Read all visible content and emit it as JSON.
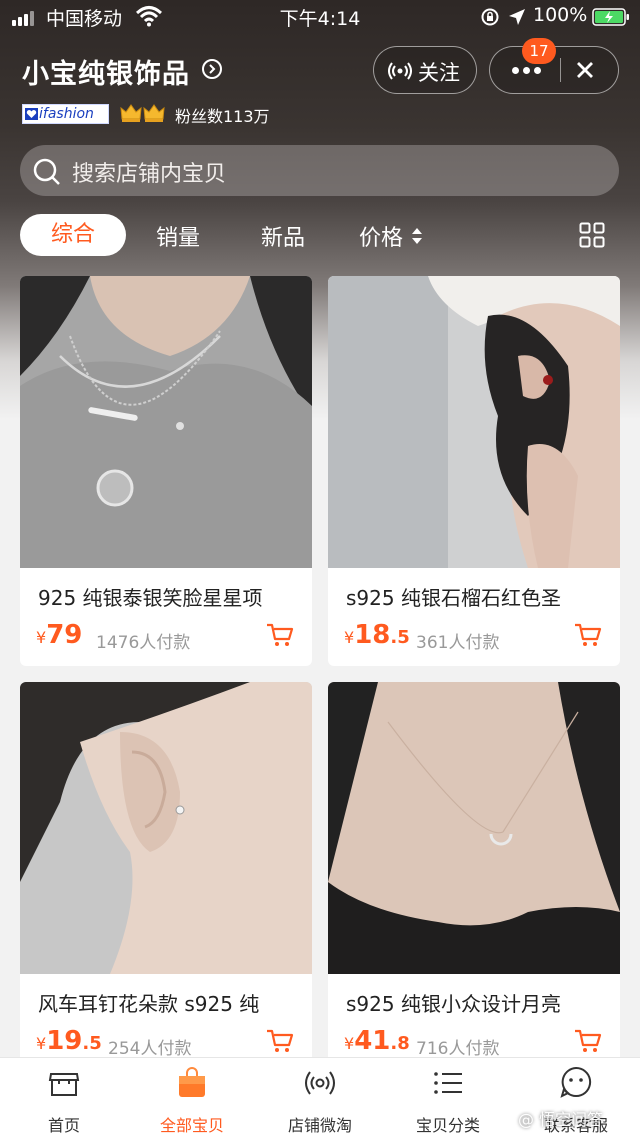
{
  "status_bar": {
    "carrier": "中国移动",
    "time": "下午4:14",
    "battery": "100%"
  },
  "shop": {
    "name": "小宝纯银饰品",
    "follow_label": "关注",
    "notification_count": "17",
    "badge_label": "ifashion",
    "fans_label": "粉丝数113万"
  },
  "search": {
    "placeholder": "搜索店铺内宝贝"
  },
  "sort_tabs": [
    {
      "label": "综合",
      "active": true
    },
    {
      "label": "销量"
    },
    {
      "label": "新品"
    },
    {
      "label": "价格"
    }
  ],
  "products": [
    {
      "title": "925 纯银泰银笑脸星星项",
      "currency": "¥",
      "price_int": "79",
      "price_dec": "",
      "sold": "1476人付款"
    },
    {
      "title": "s925 纯银石榴石红色圣",
      "currency": "¥",
      "price_int": "18",
      "price_dec": ".5",
      "sold": "361人付款"
    },
    {
      "title": "风车耳钉花朵款 s925 纯",
      "currency": "¥",
      "price_int": "19",
      "price_dec": ".5",
      "sold": "254人付款"
    },
    {
      "title": "s925 纯银小众设计月亮",
      "currency": "¥",
      "price_int": "41",
      "price_dec": ".8",
      "sold": "716人付款"
    }
  ],
  "tab_bar": [
    {
      "label": "首页",
      "icon": "storefront-icon"
    },
    {
      "label": "全部宝贝",
      "icon": "shopping-bag-icon",
      "active": true
    },
    {
      "label": "店铺微淘",
      "icon": "broadcast-icon"
    },
    {
      "label": "宝贝分类",
      "icon": "list-icon"
    },
    {
      "label": "联系客服",
      "icon": "chat-face-icon"
    }
  ],
  "watermark": "@ 悟空问答",
  "colors": {
    "accent": "#ff5a1f",
    "header_dark": "#2e2826",
    "text": "#222222",
    "muted": "#999999"
  }
}
